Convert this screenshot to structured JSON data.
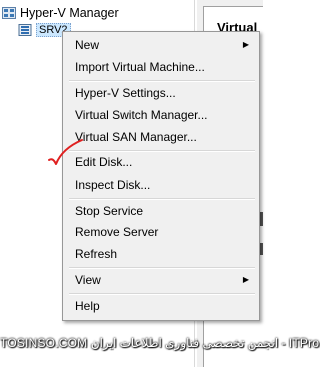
{
  "tree": {
    "root_label": "Hyper-V Manager",
    "child_label": "SRV2"
  },
  "right_pane": {
    "header": "Virtual"
  },
  "context_menu": {
    "items": [
      {
        "label": "New",
        "has_submenu": true
      },
      {
        "label": "Import Virtual Machine..."
      },
      {
        "label": "Hyper-V Settings..."
      },
      {
        "label": "Virtual Switch Manager..."
      },
      {
        "label": "Virtual SAN Manager..."
      },
      {
        "label": "Edit Disk..."
      },
      {
        "label": "Inspect Disk..."
      },
      {
        "label": "Stop Service"
      },
      {
        "label": "Remove Server"
      },
      {
        "label": "Refresh"
      },
      {
        "label": "View",
        "has_submenu": true
      },
      {
        "label": "Help"
      }
    ]
  },
  "annotation": {
    "mark": "red-checkmark",
    "color": "#e02020"
  },
  "watermark": {
    "text": "TOSINSO.COM انجمن تخصصی فناوری اطلاعات ایران - ITPro.ir"
  }
}
